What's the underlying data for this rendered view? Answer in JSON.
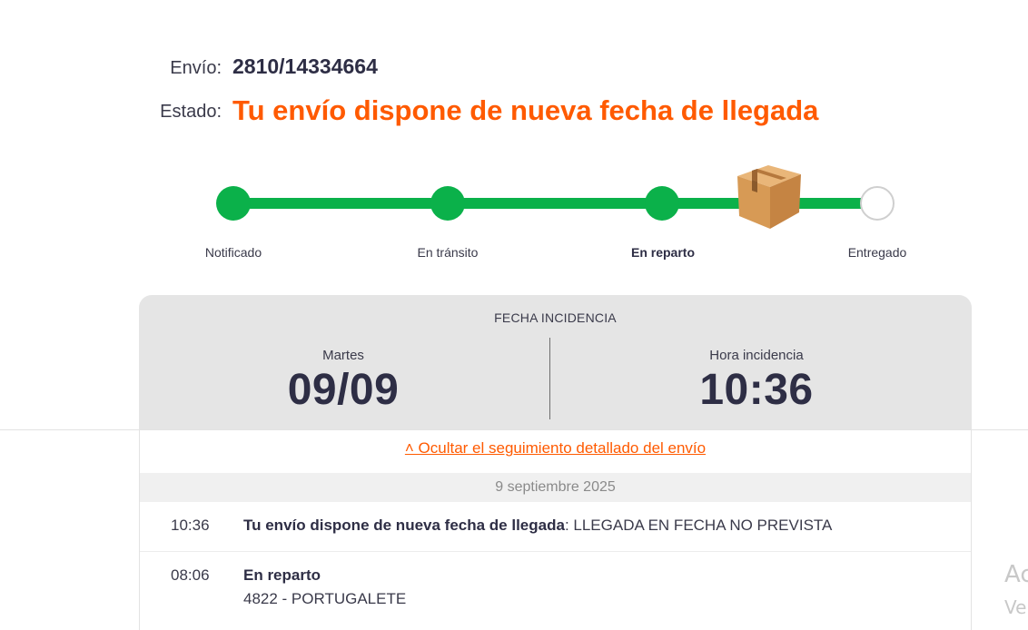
{
  "header": {
    "envio_label": "Envío:",
    "envio_number": "2810/14334664",
    "estado_label": "Estado:",
    "estado_value": "Tu envío dispone de nueva fecha de llegada"
  },
  "progress": {
    "steps": [
      {
        "label": "Notificado",
        "status": "done"
      },
      {
        "label": "En tránsito",
        "status": "done"
      },
      {
        "label": "En reparto",
        "status": "current"
      },
      {
        "label": "Entregado",
        "status": "pending"
      }
    ],
    "color_done": "#0bb14a",
    "icon": "package-box-icon"
  },
  "incidence": {
    "title": "FECHA INCIDENCIA",
    "day_label": "Martes",
    "date": "09/09",
    "time_label": "Hora incidencia",
    "time": "10:36"
  },
  "tracking": {
    "toggle_label": "˄ Ocultar el seguimiento detallado del envío",
    "date_header": "9 septiembre 2025",
    "events": [
      {
        "time": "10:36",
        "title": "Tu envío dispone de nueva fecha de llegada",
        "detail": ": LLEGADA EN FECHA NO PREVISTA"
      },
      {
        "time": "08:06",
        "title": "En reparto",
        "detail": "4822 - PORTUGALETE"
      }
    ]
  },
  "watermark": {
    "line1": "Ac",
    "line2": "Ve"
  },
  "colors": {
    "accent": "#ff5a00",
    "dark_text": "#2e2e45",
    "panel_bg": "#e5e5e5"
  }
}
